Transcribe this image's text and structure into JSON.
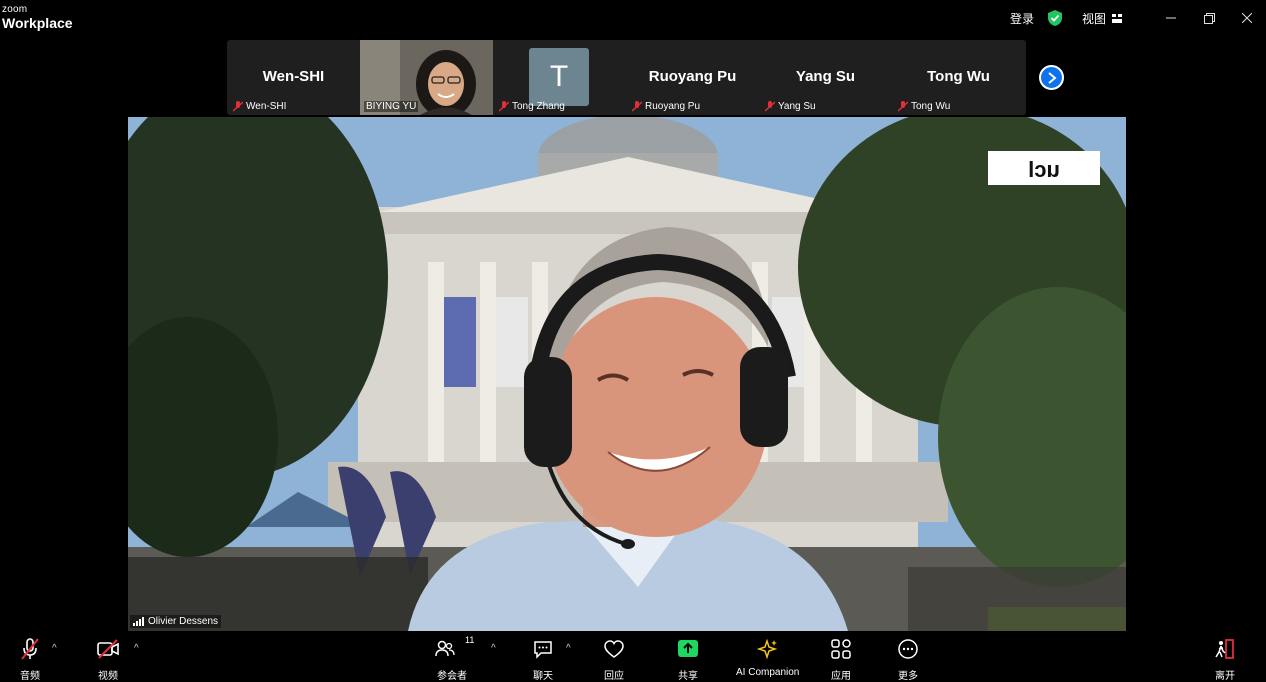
{
  "app": {
    "brand_small": "zoom",
    "brand_large": "Workplace"
  },
  "titlebar": {
    "login": "登录",
    "view": "视图",
    "shield_color": "#22c55e",
    "window_controls": [
      "minimize-icon",
      "restore-icon",
      "close-icon"
    ]
  },
  "thumbnails": [
    {
      "name": "Wen-SHI",
      "label": "Wen-SHI",
      "muted": true
    },
    {
      "name": "BIYING YU",
      "label": "BIYING YU",
      "video": true
    },
    {
      "initial": "T",
      "label": "Tong Zhang",
      "muted": true
    },
    {
      "name": "Ruoyang Pu",
      "label": "Ruoyang Pu",
      "muted": true
    },
    {
      "name": "Yang Su",
      "label": "Yang Su",
      "muted": true
    },
    {
      "name": "Tong Wu",
      "label": "Tong Wu",
      "muted": true
    }
  ],
  "main_video": {
    "speaker": "Olivier Dessens",
    "logo_text": "ucl"
  },
  "toolbar": {
    "audio": "音频",
    "video": "视频",
    "participants": "参会者",
    "participants_count": "11",
    "chat": "聊天",
    "react": "回应",
    "share": "共享",
    "ai_companion": "AI Companion",
    "apps": "应用",
    "more": "更多",
    "leave": "离开",
    "accent": "#0e72ed",
    "share_color": "#1ed760",
    "mute_color": "#e02f3a"
  }
}
